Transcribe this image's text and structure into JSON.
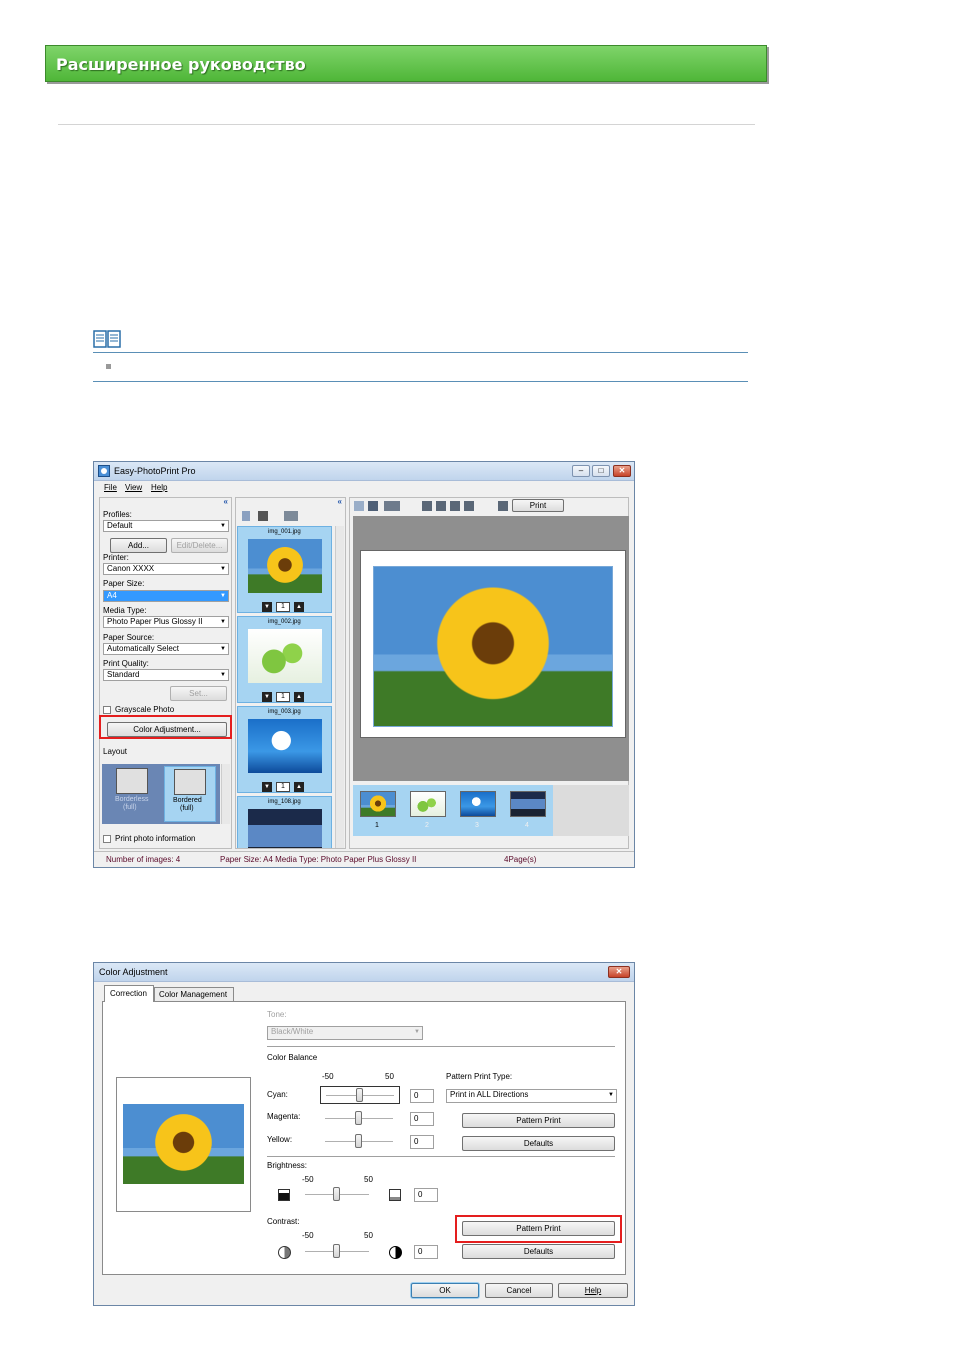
{
  "header": {
    "title": "Расширенное руководство"
  },
  "main_window": {
    "title": "Easy-PhotoPrint Pro",
    "menu": [
      "File",
      "View",
      "Help"
    ],
    "collapse": "«",
    "left_panel": {
      "profiles_label": "Profiles:",
      "profiles_value": "Default",
      "add_btn": "Add...",
      "edit_btn": "Edit/Delete...",
      "printer_label": "Printer:",
      "printer_value": "Canon XXXX",
      "paper_size_label": "Paper Size:",
      "paper_size_value": "A4",
      "media_type_label": "Media Type:",
      "media_type_value": "Photo Paper Plus Glossy II",
      "paper_source_label": "Paper Source:",
      "paper_source_value": "Automatically Select",
      "print_quality_label": "Print Quality:",
      "print_quality_value": "Standard",
      "set_btn": "Set...",
      "grayscale_label": "Grayscale Photo",
      "color_adjust_btn": "Color Adjustment...",
      "layout_label": "Layout",
      "layout_items": [
        {
          "line1": "Borderless",
          "line2": "(full)"
        },
        {
          "line1": "Bordered",
          "line2": "(full)"
        }
      ],
      "print_info_label": "Print photo information"
    },
    "thumbs": [
      {
        "name": "img_001.jpg",
        "count": "1"
      },
      {
        "name": "img_002.jpg",
        "count": "1"
      },
      {
        "name": "img_003.jpg",
        "count": "1"
      },
      {
        "name": "img_108.jpg"
      }
    ],
    "print_btn": "Print",
    "strip": [
      "1",
      "2",
      "3",
      "4"
    ],
    "status": {
      "images": "Number of images: 4",
      "paper": "Paper Size: A4   Media Type: Photo Paper Plus Glossy II",
      "pages": "4Page(s)"
    }
  },
  "color_dialog": {
    "title": "Color Adjustment",
    "close": "✕",
    "tabs": [
      "Correction",
      "Color Management"
    ],
    "tone_label": "Tone:",
    "tone_value": "Black/White",
    "color_balance_label": "Color Balance",
    "scale_min": "-50",
    "scale_max": "50",
    "cyan_label": "Cyan:",
    "cyan_value": "0",
    "magenta_label": "Magenta:",
    "magenta_value": "0",
    "yellow_label": "Yellow:",
    "yellow_value": "0",
    "pattern_type_label": "Pattern Print Type:",
    "pattern_type_value": "Print in ALL Directions",
    "pattern_print_btn": "Pattern Print",
    "defaults_btn": "Defaults",
    "brightness_label": "Brightness:",
    "brightness_value": "0",
    "contrast_label": "Contrast:",
    "contrast_value": "0",
    "pattern_print_btn2": "Pattern Print",
    "defaults_btn2": "Defaults",
    "ok_btn": "OK",
    "cancel_btn": "Cancel",
    "help_btn": "Help"
  }
}
